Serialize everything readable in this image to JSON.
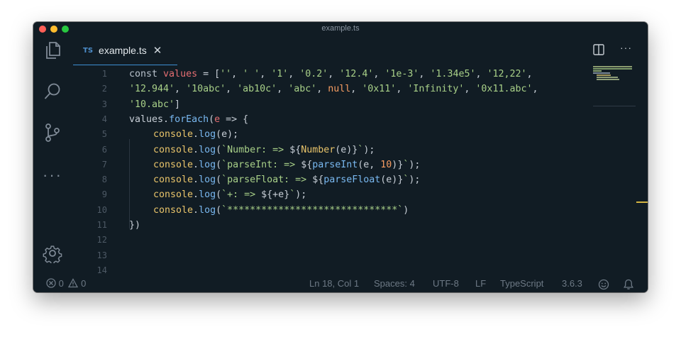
{
  "window": {
    "title": "example.ts"
  },
  "activity_bar": {
    "items": [
      "files-icon",
      "search-icon",
      "source-control-icon",
      "more-icon"
    ],
    "manage": "gear-icon"
  },
  "tab": {
    "lang_badge": "TS",
    "name": "example.ts",
    "close_glyph": "✕"
  },
  "editor_actions": {
    "split": "split-editor-icon",
    "more": "···"
  },
  "lines": [
    {
      "n": "1",
      "indent": 0,
      "tokens": [
        {
          "t": "const ",
          "c": "keyword"
        },
        {
          "t": "values",
          "c": "variable"
        },
        {
          "t": " = [",
          "c": "plain"
        },
        {
          "t": "''",
          "c": "string"
        },
        {
          "t": ", ",
          "c": "plain"
        },
        {
          "t": "' '",
          "c": "string"
        },
        {
          "t": ", ",
          "c": "plain"
        },
        {
          "t": "'1'",
          "c": "string"
        },
        {
          "t": ", ",
          "c": "plain"
        },
        {
          "t": "'0.2'",
          "c": "string"
        },
        {
          "t": ", ",
          "c": "plain"
        },
        {
          "t": "'12.4'",
          "c": "string"
        },
        {
          "t": ", ",
          "c": "plain"
        },
        {
          "t": "'1e-3'",
          "c": "string"
        },
        {
          "t": ", ",
          "c": "plain"
        },
        {
          "t": "'1.34e5'",
          "c": "string"
        },
        {
          "t": ", ",
          "c": "plain"
        },
        {
          "t": "'12,22'",
          "c": "string"
        },
        {
          "t": ",",
          "c": "plain"
        }
      ]
    },
    {
      "n": "2",
      "indent": 0,
      "tokens": [
        {
          "t": "'12.944'",
          "c": "string"
        },
        {
          "t": ", ",
          "c": "plain"
        },
        {
          "t": "'10abc'",
          "c": "string"
        },
        {
          "t": ", ",
          "c": "plain"
        },
        {
          "t": "'ab10c'",
          "c": "string"
        },
        {
          "t": ", ",
          "c": "plain"
        },
        {
          "t": "'abc'",
          "c": "string"
        },
        {
          "t": ", ",
          "c": "plain"
        },
        {
          "t": "null",
          "c": "null"
        },
        {
          "t": ", ",
          "c": "plain"
        },
        {
          "t": "'0x11'",
          "c": "string"
        },
        {
          "t": ", ",
          "c": "plain"
        },
        {
          "t": "'Infinity'",
          "c": "string"
        },
        {
          "t": ", ",
          "c": "plain"
        },
        {
          "t": "'0x11.abc'",
          "c": "string"
        },
        {
          "t": ",",
          "c": "plain"
        }
      ]
    },
    {
      "n": "3",
      "indent": 0,
      "tokens": [
        {
          "t": "'10.abc'",
          "c": "string"
        },
        {
          "t": "]",
          "c": "plain"
        }
      ]
    },
    {
      "n": "4",
      "indent": 0,
      "tokens": [
        {
          "t": "values",
          "c": "plain"
        },
        {
          "t": ".",
          "c": "plain"
        },
        {
          "t": "forEach",
          "c": "func"
        },
        {
          "t": "(",
          "c": "plain"
        },
        {
          "t": "e",
          "c": "param"
        },
        {
          "t": " => {",
          "c": "plain"
        }
      ]
    },
    {
      "n": "5",
      "indent": 1,
      "tokens": [
        {
          "t": "console",
          "c": "builtin"
        },
        {
          "t": ".",
          "c": "plain"
        },
        {
          "t": "log",
          "c": "func"
        },
        {
          "t": "(e);",
          "c": "plain"
        }
      ]
    },
    {
      "n": "6",
      "indent": 1,
      "tokens": [
        {
          "t": "console",
          "c": "builtin"
        },
        {
          "t": ".",
          "c": "plain"
        },
        {
          "t": "log",
          "c": "func"
        },
        {
          "t": "(",
          "c": "plain"
        },
        {
          "t": "`Number: => ",
          "c": "string"
        },
        {
          "t": "${",
          "c": "interp"
        },
        {
          "t": "Number",
          "c": "builtin"
        },
        {
          "t": "(e)",
          "c": "plain"
        },
        {
          "t": "}",
          "c": "interp"
        },
        {
          "t": "`",
          "c": "string"
        },
        {
          "t": ");",
          "c": "plain"
        }
      ]
    },
    {
      "n": "7",
      "indent": 1,
      "tokens": [
        {
          "t": "console",
          "c": "builtin"
        },
        {
          "t": ".",
          "c": "plain"
        },
        {
          "t": "log",
          "c": "func"
        },
        {
          "t": "(",
          "c": "plain"
        },
        {
          "t": "`parseInt: => ",
          "c": "string"
        },
        {
          "t": "${",
          "c": "interp"
        },
        {
          "t": "parseInt",
          "c": "func"
        },
        {
          "t": "(e, ",
          "c": "plain"
        },
        {
          "t": "10",
          "c": "number"
        },
        {
          "t": ")",
          "c": "plain"
        },
        {
          "t": "}",
          "c": "interp"
        },
        {
          "t": "`",
          "c": "string"
        },
        {
          "t": ");",
          "c": "plain"
        }
      ]
    },
    {
      "n": "8",
      "indent": 1,
      "tokens": [
        {
          "t": "console",
          "c": "builtin"
        },
        {
          "t": ".",
          "c": "plain"
        },
        {
          "t": "log",
          "c": "func"
        },
        {
          "t": "(",
          "c": "plain"
        },
        {
          "t": "`parseFloat: => ",
          "c": "string"
        },
        {
          "t": "${",
          "c": "interp"
        },
        {
          "t": "parseFloat",
          "c": "func"
        },
        {
          "t": "(e)",
          "c": "plain"
        },
        {
          "t": "}",
          "c": "interp"
        },
        {
          "t": "`",
          "c": "string"
        },
        {
          "t": ");",
          "c": "plain"
        }
      ]
    },
    {
      "n": "9",
      "indent": 1,
      "tokens": [
        {
          "t": "console",
          "c": "builtin"
        },
        {
          "t": ".",
          "c": "plain"
        },
        {
          "t": "log",
          "c": "func"
        },
        {
          "t": "(",
          "c": "plain"
        },
        {
          "t": "`+: => ",
          "c": "string"
        },
        {
          "t": "${",
          "c": "interp"
        },
        {
          "t": "+e",
          "c": "plain"
        },
        {
          "t": "}",
          "c": "interp"
        },
        {
          "t": "`",
          "c": "string"
        },
        {
          "t": ");",
          "c": "plain"
        }
      ]
    },
    {
      "n": "10",
      "indent": 1,
      "tokens": [
        {
          "t": "console",
          "c": "builtin"
        },
        {
          "t": ".",
          "c": "plain"
        },
        {
          "t": "log",
          "c": "func"
        },
        {
          "t": "(",
          "c": "plain"
        },
        {
          "t": "`******************************`",
          "c": "string"
        },
        {
          "t": ")",
          "c": "plain"
        }
      ]
    },
    {
      "n": "11",
      "indent": 0,
      "tokens": [
        {
          "t": "})",
          "c": "plain"
        }
      ]
    },
    {
      "n": "12",
      "indent": 0,
      "tokens": []
    },
    {
      "n": "13",
      "indent": 0,
      "tokens": []
    },
    {
      "n": "14",
      "indent": 0,
      "tokens": []
    }
  ],
  "status": {
    "errors": "0",
    "warnings": "0",
    "cursor": "Ln 18, Col 1",
    "spaces": "Spaces: 4",
    "encoding": "UTF-8",
    "eol": "LF",
    "language": "TypeScript",
    "version": "3.6.3"
  },
  "colors": {
    "window_bg": "#111c24",
    "accent": "#3c8fd1",
    "string": "#a8d088",
    "variable": "#e56e72",
    "function": "#79b8f0",
    "builtin": "#e9c46a",
    "number": "#f79d62",
    "scroll_marker": "#d4b441"
  }
}
